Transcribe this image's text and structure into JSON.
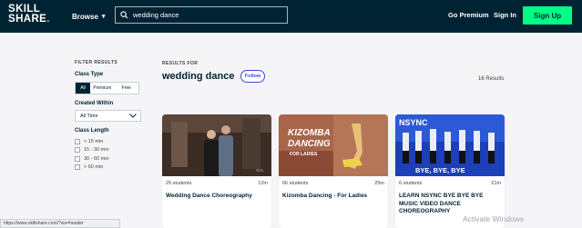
{
  "header": {
    "logo_line1": "SKILL",
    "logo_line2": "SHARE",
    "logo_dot": ".",
    "browse_label": "Browse",
    "search_value": "wedding dance",
    "go_premium_label": "Go Premium",
    "sign_in_label": "Sign In",
    "sign_up_label": "Sign Up"
  },
  "filters": {
    "heading": "FILTER RESULTS",
    "class_type_label": "Class Type",
    "class_type_options": [
      "All",
      "Premium",
      "Free"
    ],
    "class_type_selected": "All",
    "created_within_label": "Created Within",
    "created_within_value": "All Time",
    "class_length_label": "Class Length",
    "class_length_options": [
      "< 15 min",
      "15 - 30 min",
      "30 - 60 min",
      "> 60 min"
    ]
  },
  "results": {
    "results_for_label": "RESULTS FOR",
    "query": "wedding dance",
    "follow_label": "Follow",
    "count": "16 Results"
  },
  "cards": [
    {
      "students": "29 students",
      "duration": "12m",
      "title": "Wedding Dance Choreography",
      "thumb_overlay": ""
    },
    {
      "students": "66 students",
      "duration": "25m",
      "title": "Kizomba Dancing - For Ladies",
      "thumb_overlay_1": "KIZOMBA",
      "thumb_overlay_2": "DANCING",
      "thumb_overlay_3": "FOR LADIES"
    },
    {
      "students": "6 students",
      "duration": "21m",
      "title": "LEARN NSYNC BYE BYE BYE MUSIC VIDEO DANCE CHOREOGRAPHY",
      "thumb_overlay_1": "NSYNC",
      "thumb_overlay_2": "BYE, BYE, BYE"
    }
  ],
  "status_url": "https://www.skillshare.com/?via=header",
  "watermark": "Activate Windows",
  "colors": {
    "brand_dark": "#002333",
    "accent_green": "#00ff84",
    "follow_blue": "#3b4bd8"
  }
}
